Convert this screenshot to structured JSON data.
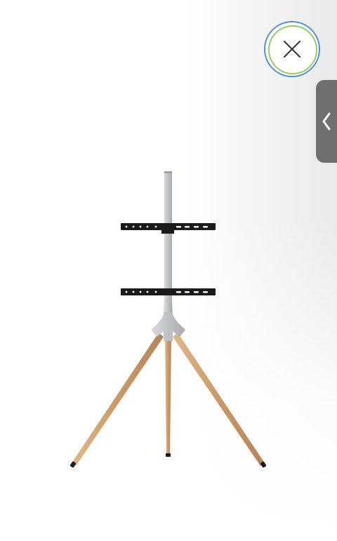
{
  "viewer": {
    "image_subject": "tripod-tv-stand"
  },
  "controls": {
    "close_icon": "close-icon",
    "side_tab_icon": "chevron-left-icon"
  },
  "colors": {
    "close_ring_outer": "#4a90d9",
    "close_ring_inner": "#9bc86a",
    "side_tab_bg": "#6f6f6f",
    "wood": "#c99a68",
    "metal": "#c6c9cc",
    "bracket": "#1a1a1a"
  }
}
